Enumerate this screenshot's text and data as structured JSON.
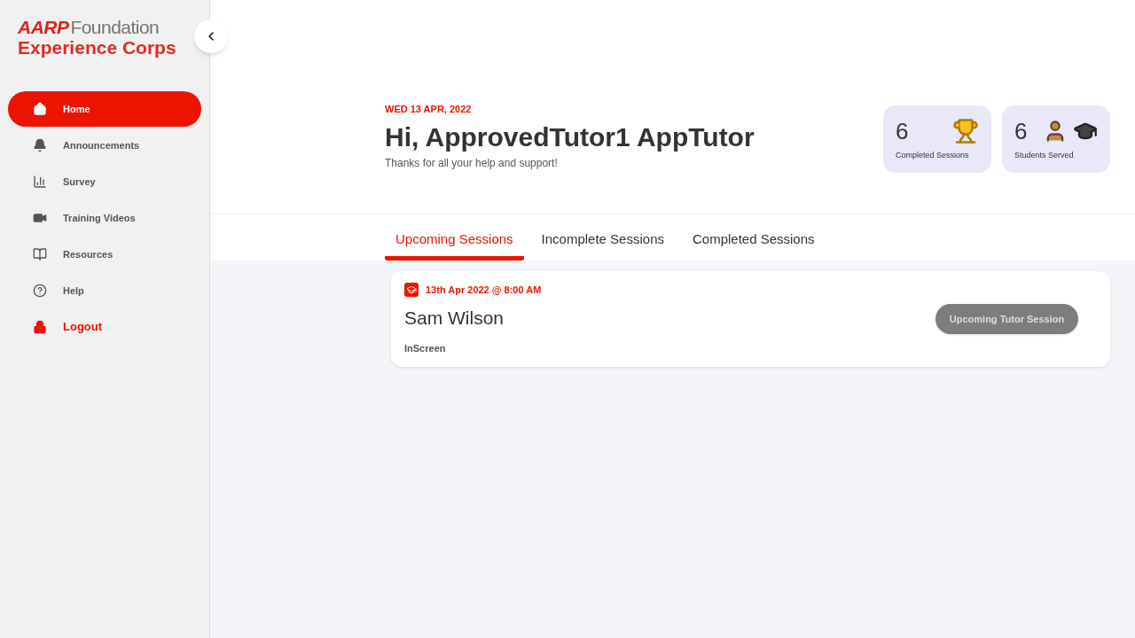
{
  "logo": {
    "brand": "AARP",
    "line_1": "Foundation",
    "line_2": "Experience Corps"
  },
  "sidebar": {
    "items": [
      {
        "label": "Home",
        "kind": "home",
        "selected": true
      },
      {
        "label": "Announcements",
        "kind": "bell",
        "selected": false
      },
      {
        "label": "Survey",
        "kind": "chart",
        "selected": false
      },
      {
        "label": "Training Videos",
        "kind": "video",
        "selected": false
      },
      {
        "label": "Resources",
        "kind": "book",
        "selected": false
      },
      {
        "label": "Help",
        "kind": "help",
        "selected": false
      },
      {
        "label": "Logout",
        "kind": "logout",
        "selected": false
      }
    ]
  },
  "header": {
    "date": "WED 13 APR, 2022",
    "greeting": "Hi, ApprovedTutor1 AppTutor",
    "subtitle": "Thanks for all your help and support!"
  },
  "stats": [
    {
      "value": "6",
      "label": "Completed Sessions",
      "kind": "trophy"
    },
    {
      "value": "6",
      "label": "Students Served",
      "kind": "students"
    }
  ],
  "tabs": [
    {
      "label": "Upcoming Sessions",
      "selected": true
    },
    {
      "label": "Incomplete Sessions",
      "selected": false
    },
    {
      "label": "Completed Sessions",
      "selected": false
    }
  ],
  "sessions": [
    {
      "datetime": "13th Apr 2022 @ 8:00 AM",
      "student": "Sam Wilson",
      "location": "InScreen",
      "status_button": "Upcoming Tutor Session"
    }
  ]
}
